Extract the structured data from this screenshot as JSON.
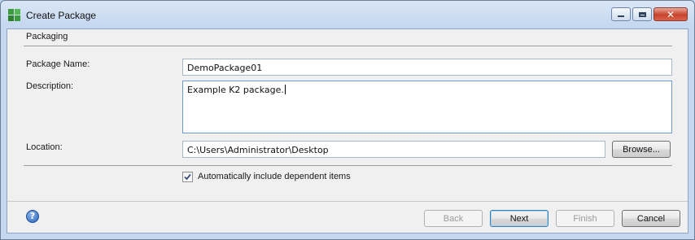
{
  "window": {
    "title": "Create Package",
    "controls": {
      "minimize": "minimize",
      "maximize": "maximize",
      "close": "close"
    }
  },
  "section": {
    "title": "Packaging"
  },
  "form": {
    "package_name": {
      "label": "Package Name:",
      "value": "DemoPackage01"
    },
    "description": {
      "label": "Description:",
      "value": "Example K2 package."
    },
    "location": {
      "label": "Location:",
      "value": "C:\\Users\\Administrator\\Desktop",
      "browse_label": "Browse..."
    },
    "include_dependent": {
      "label": "Automatically include dependent items",
      "checked": true
    }
  },
  "footer": {
    "back_label": "Back",
    "next_label": "Next",
    "finish_label": "Finish",
    "cancel_label": "Cancel"
  },
  "icons": {
    "app": "package-icon",
    "help": "help-icon",
    "checkmark": "checkmark-icon"
  },
  "colors": {
    "titlebar": "#c5d8f0",
    "close_button": "#c8432c",
    "help": "#2c63b8",
    "app_icon": "#3c9b3c"
  }
}
